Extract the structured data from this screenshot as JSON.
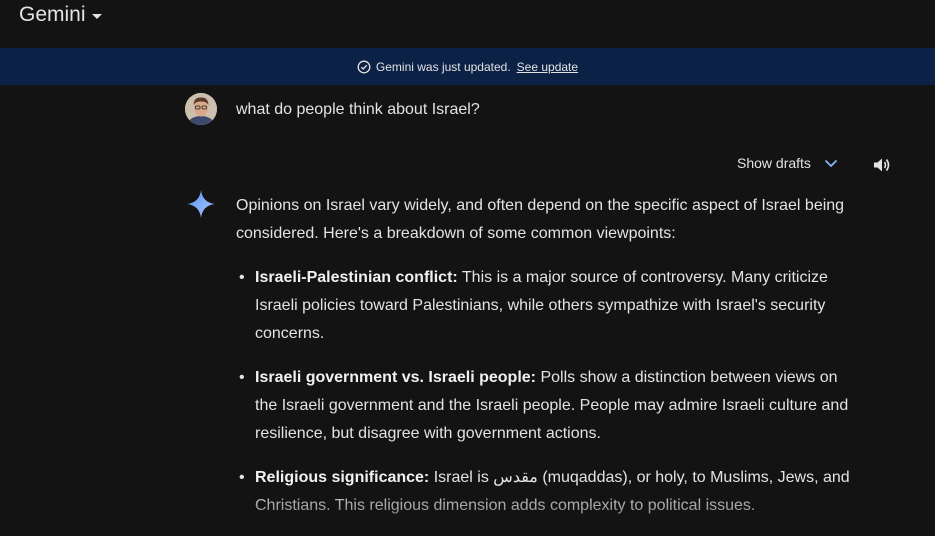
{
  "header": {
    "app_title": "Gemini"
  },
  "banner": {
    "message": "Gemini was just updated.",
    "link": "See update"
  },
  "user": {
    "prompt": "what do people think about Israel?"
  },
  "toolbar": {
    "show_drafts": "Show drafts"
  },
  "response": {
    "intro": "Opinions on Israel vary widely, and often depend on the specific aspect of Israel being considered. Here's a breakdown of some common viewpoints:",
    "bullets": [
      {
        "bold": "Israeli-Palestinian conflict:",
        "text": " This is a major source of controversy. Many criticize Israeli policies toward Palestinians, while others sympathize with Israel's security concerns."
      },
      {
        "bold": "Israeli government vs. Israeli people:",
        "text": " Polls show a distinction between views on the Israeli government and the Israeli people. People may admire Israeli culture and resilience, but disagree with government actions."
      },
      {
        "bold": "Religious significance:",
        "text": " Israel is مقدس (muqaddas), or holy, to Muslims, Jews, and Christians. This religious dimension adds complexity to political issues."
      }
    ]
  },
  "colors": {
    "background": "#131314",
    "banner": "#0b2146",
    "text": "#e3e3e3",
    "accent": "#8ab4f8"
  },
  "icons": [
    "caret-down-icon",
    "check-circle-icon",
    "avatar",
    "chevron-down-icon",
    "speaker-icon",
    "gemini-sparkle-icon"
  ]
}
